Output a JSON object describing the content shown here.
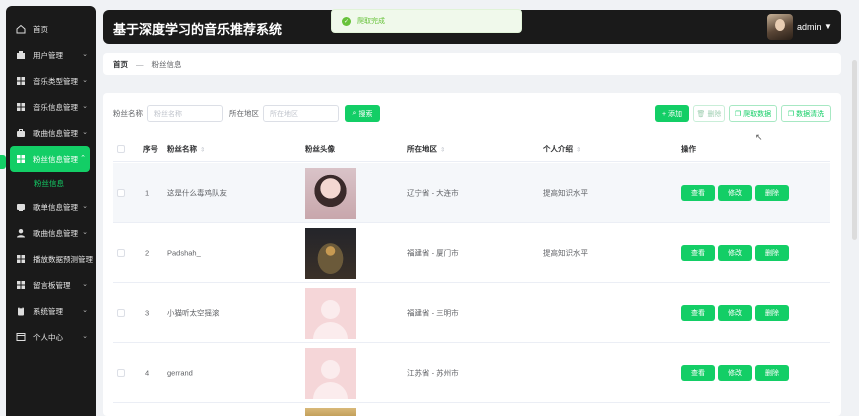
{
  "app": {
    "title": "基于深度学习的音乐推荐系统",
    "user": "admin",
    "caret": "▼"
  },
  "toast": {
    "message": "爬取完成"
  },
  "sidebar": {
    "items": [
      {
        "label": "首页",
        "icon": "home-icon",
        "arrow": ""
      },
      {
        "label": "用户管理",
        "icon": "user-manage-icon",
        "arrow": "⌄"
      },
      {
        "label": "音乐类型管理",
        "icon": "grid-icon",
        "arrow": "⌄"
      },
      {
        "label": "音乐信息管理",
        "icon": "grid-icon",
        "arrow": "⌄"
      },
      {
        "label": "歌曲信息管理",
        "icon": "briefcase-icon",
        "arrow": "⌄"
      },
      {
        "label": "粉丝信息管理",
        "icon": "grid-icon",
        "arrow": "⌃",
        "active": true
      },
      {
        "label": "歌单信息管理",
        "icon": "disk-icon",
        "arrow": "⌄"
      },
      {
        "label": "歌曲信息管理",
        "icon": "person-icon",
        "arrow": "⌄"
      },
      {
        "label": "播放数据预测管理",
        "icon": "grid-icon",
        "arrow": ""
      },
      {
        "label": "留言板管理",
        "icon": "grid-icon",
        "arrow": "⌄"
      },
      {
        "label": "系统管理",
        "icon": "clipboard-icon",
        "arrow": "⌄"
      },
      {
        "label": "个人中心",
        "icon": "window-icon",
        "arrow": "⌄"
      }
    ],
    "sub_item": "粉丝信息"
  },
  "breadcrumb": {
    "home": "首页",
    "sep": "—",
    "current": "粉丝信息"
  },
  "search": {
    "name_label": "粉丝名称",
    "name_placeholder": "粉丝名称",
    "region_label": "所在地区",
    "region_placeholder": "所在地区",
    "button": "搜索"
  },
  "toolbar": {
    "add": "+ 添加",
    "delete": "删除",
    "crawl": "爬取数据",
    "clean": "数据清洗"
  },
  "table": {
    "headers": {
      "index": "序号",
      "name": "粉丝名称",
      "avatar": "粉丝头像",
      "region": "所在地区",
      "intro": "个人介绍",
      "ops": "操作"
    },
    "sort_glyph": "⇕",
    "rows": [
      {
        "index": "1",
        "name": "这是什么毒鸡队友",
        "region": "辽宁省 - 大连市",
        "intro": "提高知识水平",
        "pic": "anime"
      },
      {
        "index": "2",
        "name": "Padshah_",
        "region": "福建省 - 厦门市",
        "intro": "提高知识水平",
        "pic": "tree"
      },
      {
        "index": "3",
        "name": "小猫听太空摇滚",
        "region": "福建省 - 三明市",
        "intro": "",
        "pic": "default"
      },
      {
        "index": "4",
        "name": "gerrand",
        "region": "江苏省 - 苏州市",
        "intro": "",
        "pic": "default"
      }
    ],
    "actions": {
      "view": "查看",
      "edit": "修改",
      "delete": "删除"
    }
  }
}
